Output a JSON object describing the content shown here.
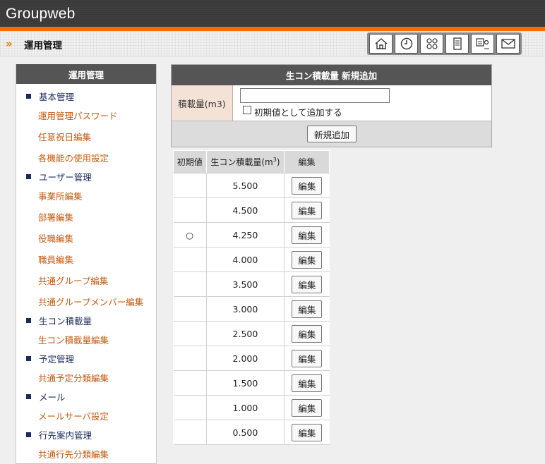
{
  "app": {
    "title": "Groupweb"
  },
  "header": {
    "page_title": "運用管理"
  },
  "nav_icons": [
    "home-icon",
    "clock-icon",
    "people-icon",
    "document-icon",
    "board-icon",
    "mail-icon"
  ],
  "sidebar": {
    "title": "運用管理",
    "sections": [
      {
        "label": "基本管理",
        "items": [
          "運用管理パスワード",
          "任意祝日編集",
          "各機能の使用設定"
        ]
      },
      {
        "label": "ユーザー管理",
        "items": [
          "事業所編集",
          "部署編集",
          "役職編集",
          "職員編集",
          "共通グループ編集",
          "共通グループメンバー編集"
        ]
      },
      {
        "label": "生コン積載量",
        "items": [
          "生コン積載量編集"
        ]
      },
      {
        "label": "予定管理",
        "items": [
          "共通予定分類編集"
        ]
      },
      {
        "label": "メール",
        "items": [
          "メールサーバ設定"
        ]
      },
      {
        "label": "行先案内管理",
        "items": [
          "共通行先分類編集"
        ]
      }
    ]
  },
  "entry_form": {
    "title": "生コン積載量 新規追加",
    "field_label": "積載量(m3)",
    "field_value": "",
    "checkbox_label": "初期値として追加する",
    "checkbox_checked": false,
    "submit_label": "新規追加"
  },
  "table": {
    "headers": {
      "default": "初期値",
      "amount": "生コン積載量(m",
      "amount_sup": "3",
      "amount_end": ")",
      "edit": "編集"
    },
    "rows": [
      {
        "default": "",
        "amount": "5.500",
        "edit": "編集"
      },
      {
        "default": "",
        "amount": "4.500",
        "edit": "編集"
      },
      {
        "default": "○",
        "amount": "4.250",
        "edit": "編集"
      },
      {
        "default": "",
        "amount": "4.000",
        "edit": "編集"
      },
      {
        "default": "",
        "amount": "3.500",
        "edit": "編集"
      },
      {
        "default": "",
        "amount": "3.000",
        "edit": "編集"
      },
      {
        "default": "",
        "amount": "2.500",
        "edit": "編集"
      },
      {
        "default": "",
        "amount": "2.000",
        "edit": "編集"
      },
      {
        "default": "",
        "amount": "1.500",
        "edit": "編集"
      },
      {
        "default": "",
        "amount": "1.000",
        "edit": "編集"
      },
      {
        "default": "",
        "amount": "0.500",
        "edit": "編集"
      }
    ]
  },
  "colors": {
    "accent": "#ff6a00",
    "topbar": "#3a3a3a",
    "link": "#c35a10",
    "panel_header": "#555555"
  }
}
